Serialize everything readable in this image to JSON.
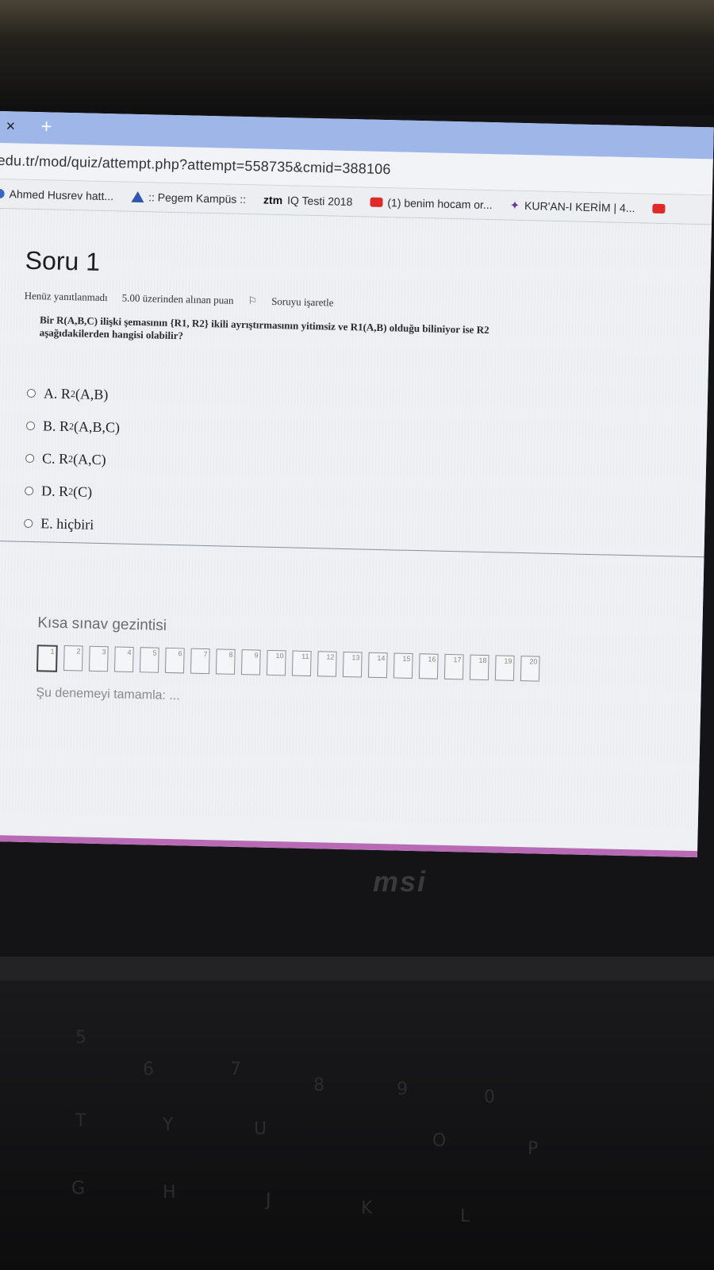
{
  "browser": {
    "tab_close": "×",
    "tab_new": "+",
    "url": "edu.tr/mod/quiz/attempt.php?attempt=558735&cmid=388106",
    "bookmarks": [
      {
        "label": "Ahmed Husrev hatt...",
        "icon": "globe-icon"
      },
      {
        "label": ":: Pegem Kampüs ::",
        "icon": "pegem-logo-icon"
      },
      {
        "label": "IQ Testi 2018",
        "icon": "atm-logo-icon",
        "icon_text": "ztm"
      },
      {
        "label": "(1) benim hocam or...",
        "icon": "youtube-icon"
      },
      {
        "label": "KUR'AN-I KERİM | 4...",
        "icon": "book-icon"
      }
    ]
  },
  "question": {
    "title": "Soru 1",
    "status": "Henüz yanıtlanmadı",
    "points": "5.00 üzerinden alınan puan",
    "flag_label": "Soruyu işaretle",
    "text": "Bir R(A,B,C) ilişki şemasının {R1, R2} ikili ayrıştırmasının yitimsiz ve R1(A,B) olduğu biliniyor ise R2 aşağıdakilerden hangisi olabilir?",
    "answers": [
      {
        "letter": "A.",
        "rel": "R",
        "sub": "2",
        "args": "(A,B)"
      },
      {
        "letter": "B.",
        "rel": "R",
        "sub": "2",
        "args": "(A,B,C)"
      },
      {
        "letter": "C.",
        "rel": "R",
        "sub": "2",
        "args": "(A,C)"
      },
      {
        "letter": "D.",
        "rel": "R",
        "sub": "2",
        "args": "(C)"
      },
      {
        "letter": "E.",
        "rel": "hiçbiri",
        "sub": "",
        "args": ""
      }
    ]
  },
  "navigation": {
    "title": "Kısa sınav gezintisi",
    "questions": [
      "1",
      "2",
      "3",
      "4",
      "5",
      "6",
      "7",
      "8",
      "9",
      "10",
      "11",
      "12",
      "13",
      "14",
      "15",
      "16",
      "17",
      "18",
      "19",
      "20"
    ],
    "current": "1",
    "finish_link": "Şu denemeyi tamamla: ..."
  },
  "device": {
    "brand": "msi"
  }
}
